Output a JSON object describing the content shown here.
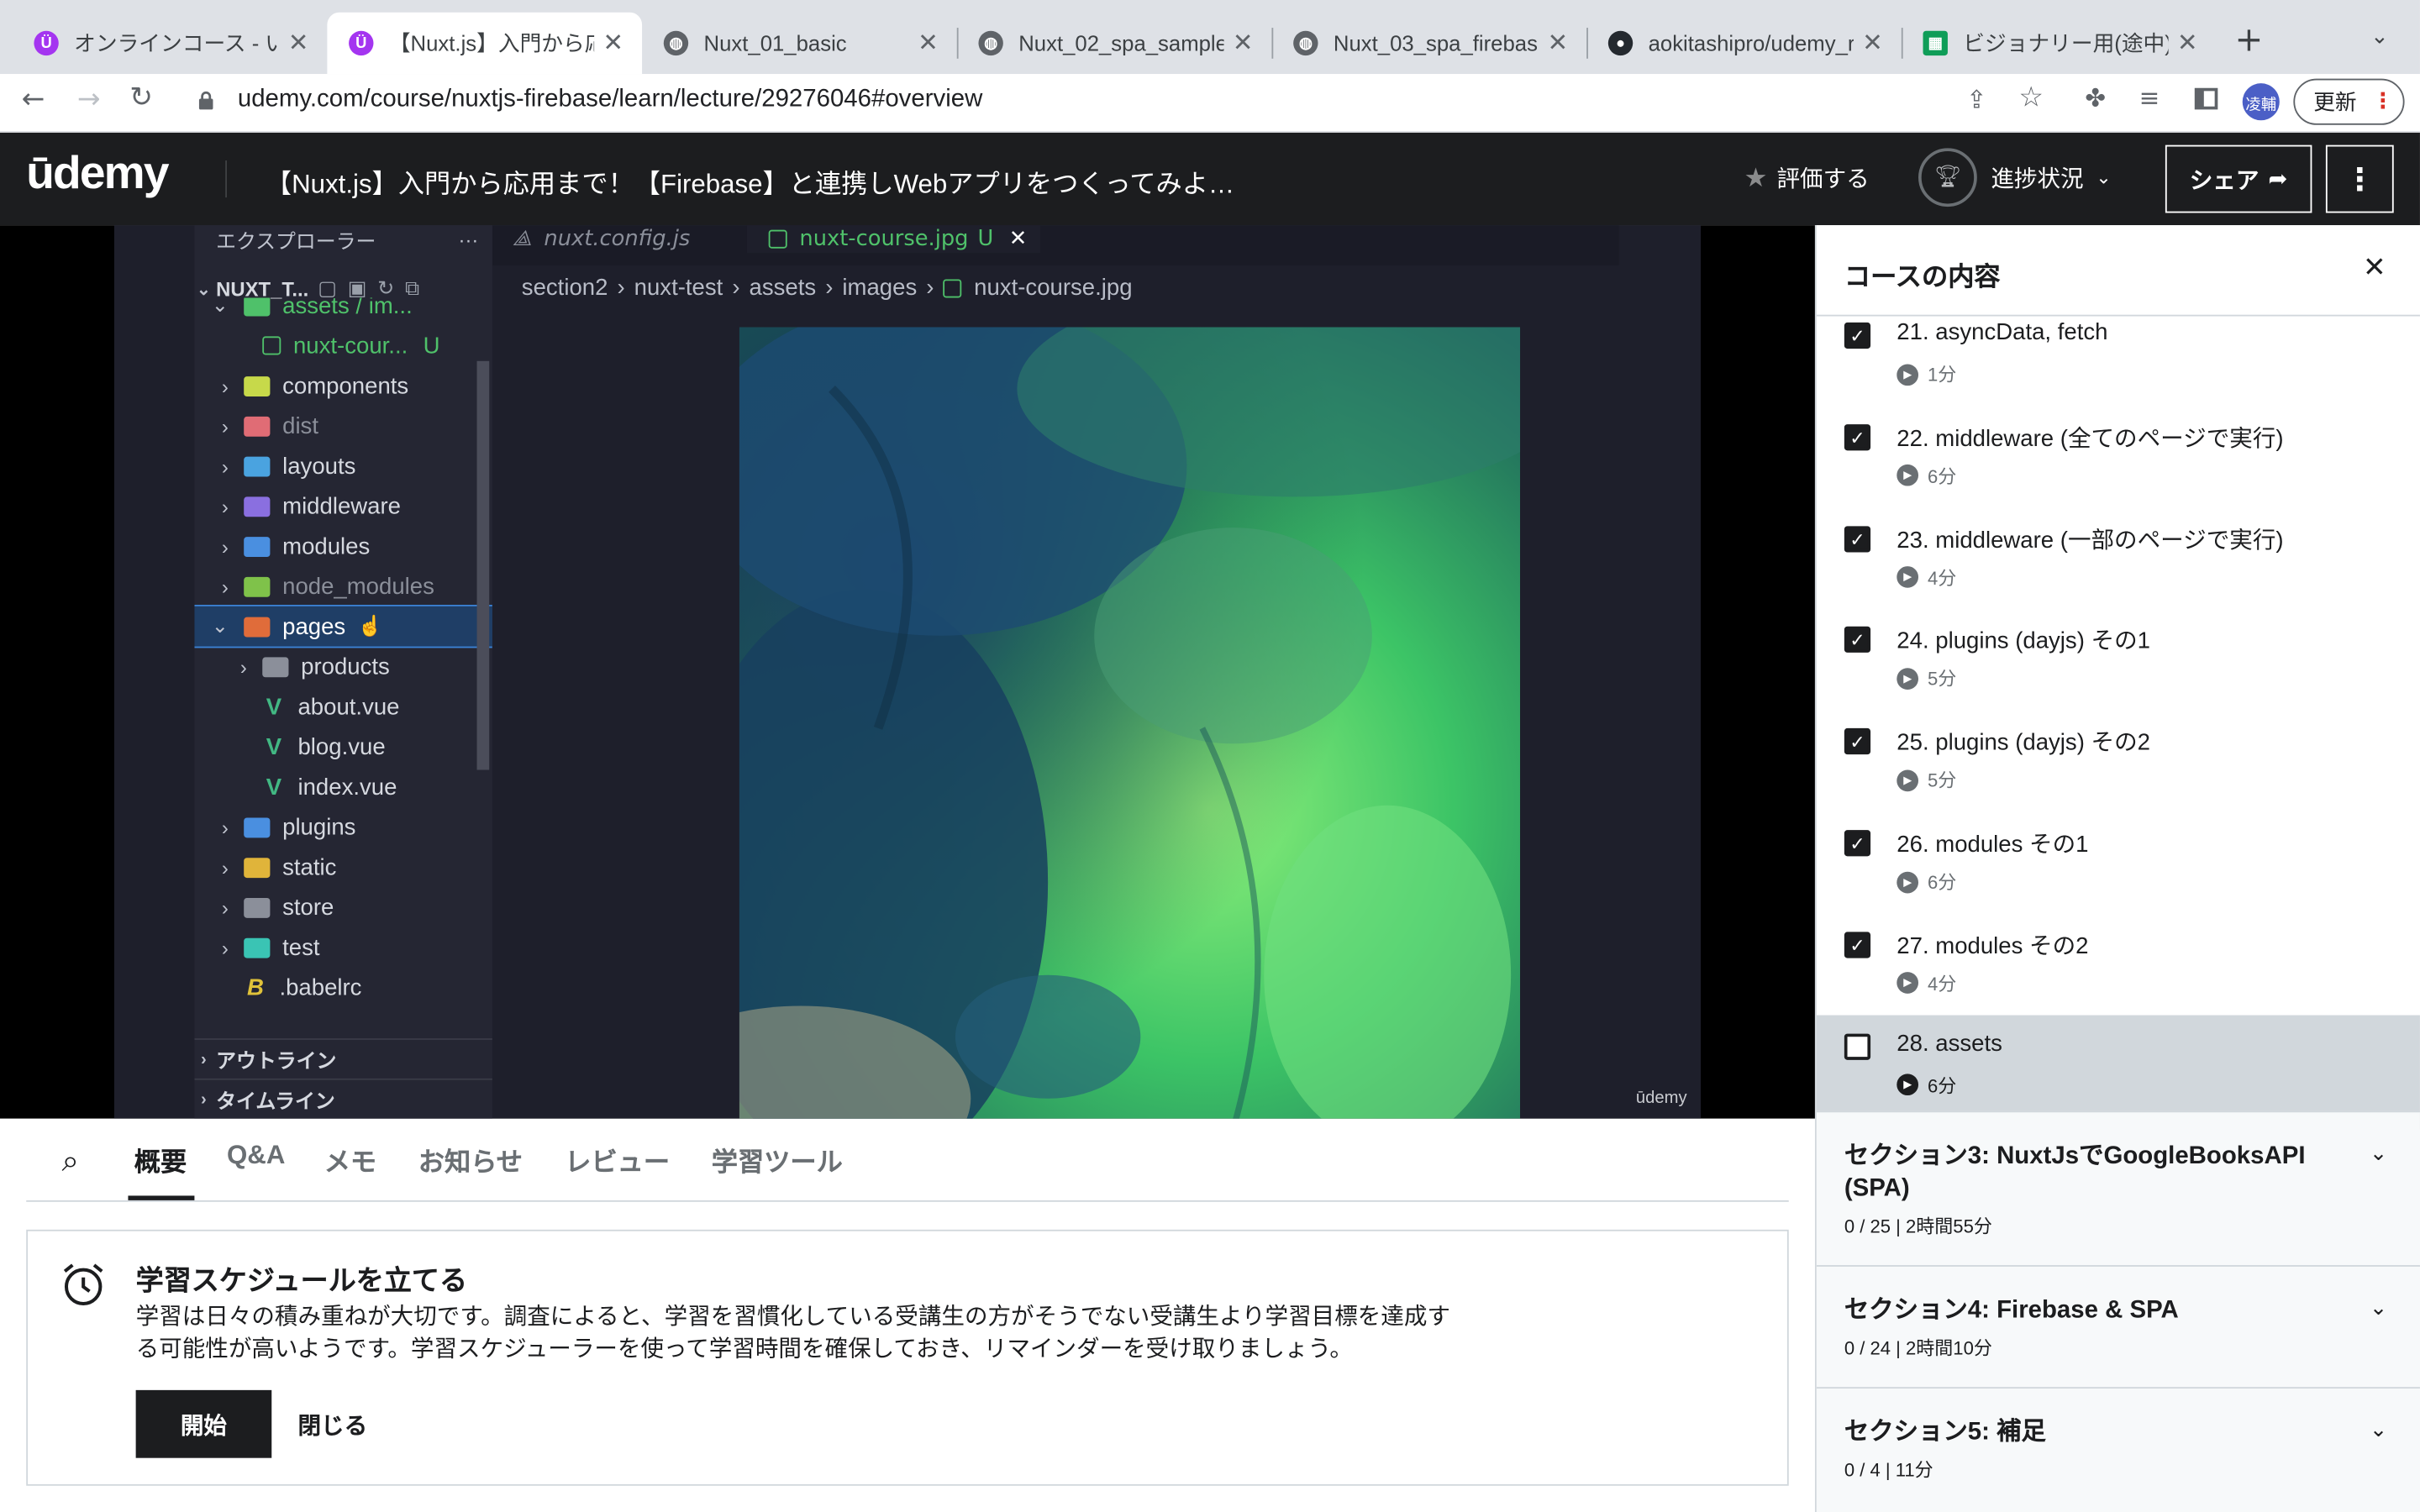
{
  "browser": {
    "tabs": [
      {
        "title": "オンラインコース - いろ",
        "favicon": "udemy-icon"
      },
      {
        "title": "【Nuxt.js】入門から応用",
        "favicon": "udemy-icon",
        "active": true
      },
      {
        "title": "Nuxt_01_basic",
        "favicon": "globe-icon"
      },
      {
        "title": "Nuxt_02_spa_sample",
        "favicon": "globe-icon"
      },
      {
        "title": "Nuxt_03_spa_firebas",
        "favicon": "globe-icon"
      },
      {
        "title": "aokitashipro/udemy_r",
        "favicon": "github-icon"
      },
      {
        "title": "ビジョナリー用(途中).xl",
        "favicon": "sheets-icon"
      }
    ],
    "url": "udemy.com/course/nuxtjs-firebase/learn/lecture/29276046#overview",
    "profile": "凌輔",
    "update_label": "更新"
  },
  "header": {
    "logo": "ūdemy",
    "course_title": "【Nuxt.js】入門から応用まで！【Firebase】と連携しWebアプリをつくってみよ…",
    "rate_label": "評価する",
    "progress_label": "進捗状況",
    "share_label": "シェア"
  },
  "video": {
    "explorer_title": "エクスプローラー",
    "project": "NUXT_T...",
    "editor_tabs": [
      {
        "label": "nuxt.config.js"
      },
      {
        "label": "nuxt-course.jpg",
        "status": "U"
      }
    ],
    "breadcrumb": [
      "section2",
      "nuxt-test",
      "assets",
      "images",
      "nuxt-course.jpg"
    ],
    "tree": [
      {
        "label": "assets / im...",
        "color": "#4fc16a",
        "open": true,
        "depth": 1
      },
      {
        "label": "nuxt-cour...",
        "color": "#4fc16a",
        "depth": 2,
        "status": "U",
        "file": true
      },
      {
        "label": "components",
        "color": "#d6d9e0",
        "depth": 1
      },
      {
        "label": "dist",
        "color": "#8b8f9a",
        "depth": 1
      },
      {
        "label": "layouts",
        "color": "#d6d9e0",
        "depth": 1
      },
      {
        "label": "middleware",
        "color": "#d6d9e0",
        "depth": 1
      },
      {
        "label": "modules",
        "color": "#d6d9e0",
        "depth": 1
      },
      {
        "label": "node_modules",
        "color": "#8b8f9a",
        "depth": 1
      },
      {
        "label": "pages",
        "color": "#ffffff",
        "open": true,
        "depth": 1,
        "selected": true
      },
      {
        "label": "products",
        "color": "#d6d9e0",
        "depth": 2
      },
      {
        "label": "about.vue",
        "color": "#d6d9e0",
        "depth": 2,
        "file": true
      },
      {
        "label": "blog.vue",
        "color": "#d6d9e0",
        "depth": 2,
        "file": true
      },
      {
        "label": "index.vue",
        "color": "#d6d9e0",
        "depth": 2,
        "file": true
      },
      {
        "label": "plugins",
        "color": "#d6d9e0",
        "depth": 1
      },
      {
        "label": "static",
        "color": "#d6d9e0",
        "depth": 1
      },
      {
        "label": "store",
        "color": "#d6d9e0",
        "depth": 1
      },
      {
        "label": "test",
        "color": "#d6d9e0",
        "depth": 1
      },
      {
        "label": ".babelrc",
        "color": "#d6d9e0",
        "depth": 1,
        "file": true
      }
    ],
    "outline_label": "アウトライン",
    "timeline_label": "タイムライン",
    "watermark": "ūdemy"
  },
  "tabs": [
    "概要",
    "Q&A",
    "メモ",
    "お知らせ",
    "レビュー",
    "学習ツール"
  ],
  "schedule": {
    "title": "学習スケジュールを立てる",
    "body1": "学習は日々の積み重ねが大切です。調査によると、学習を習慣化している受講生の方がそうでない受講生より学習目標を達成す",
    "body2": "る可能性が高いようです。学習スケジューラーを使って学習時間を確保しておき、リマインダーを受け取りましょう。",
    "start_label": "開始",
    "close_label": "閉じる"
  },
  "sidebar": {
    "title": "コースの内容",
    "lectures": [
      {
        "title": "21. asyncData, fetch",
        "duration": "1分",
        "done": true
      },
      {
        "title": "22. middleware (全てのページで実行)",
        "duration": "6分",
        "done": true
      },
      {
        "title": "23. middleware (一部のページで実行)",
        "duration": "4分",
        "done": true
      },
      {
        "title": "24. plugins (dayjs) その1",
        "duration": "5分",
        "done": true
      },
      {
        "title": "25. plugins (dayjs) その2",
        "duration": "5分",
        "done": true
      },
      {
        "title": "26. modules その1",
        "duration": "6分",
        "done": true
      },
      {
        "title": "27. modules その2",
        "duration": "4分",
        "done": true
      },
      {
        "title": "28. assets",
        "duration": "6分",
        "done": false,
        "current": true
      }
    ],
    "sections": [
      {
        "title": "セクション3: NuxtJsでGoogleBooksAPI (SPA)",
        "meta": "0 / 25 | 2時間55分"
      },
      {
        "title": "セクション4: Firebase & SPA",
        "meta": "0 / 24 | 2時間10分"
      },
      {
        "title": "セクション5: 補足",
        "meta": "0 / 4 | 11分"
      }
    ]
  },
  "colors": {
    "accent": "#a435f0",
    "dark": "#1c1d1f",
    "vscode_green": "#4fc16a"
  }
}
